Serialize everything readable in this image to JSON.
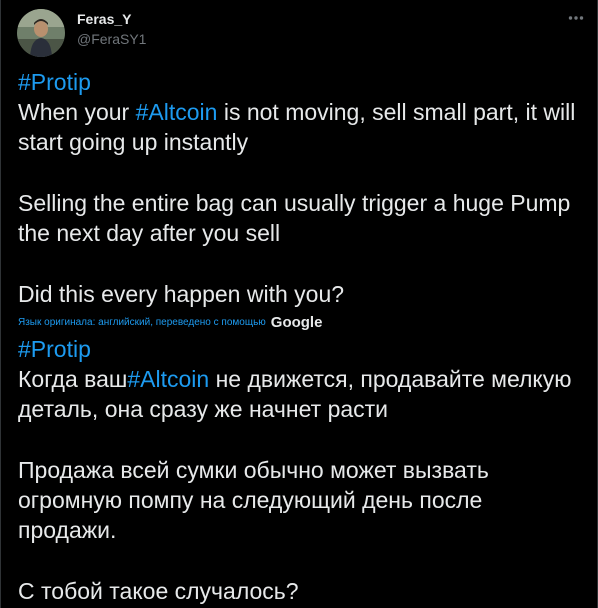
{
  "author": {
    "display_name": "Feras_Y",
    "handle": "@FeraSY1"
  },
  "icons": {
    "more": "more-horizontal-icon",
    "avatar": "avatar-photo"
  },
  "colors": {
    "background": "#000000",
    "text": "#e7e9ea",
    "muted": "#71767b",
    "link": "#1d9bf0"
  },
  "original": {
    "hashtag_1": "#Protip",
    "line_1_before": "When your ",
    "hashtag_2": "#Altcoin",
    "line_1_after": " is not moving, sell small part, it will start going up instantly",
    "paragraph_2": "Selling the entire bag can usually trigger a huge Pump the next day after you sell",
    "paragraph_3": "Did this every happen with you?"
  },
  "translation": {
    "note": "Язык оригинала: английский, переведено с помощью",
    "provider": "Google",
    "hashtag_1": "#Protip",
    "line_1_before": "Когда ваш",
    "hashtag_2": "#Altcoin",
    "line_1_after": " не движется, продавайте мелкую деталь, она сразу же начнет расти",
    "paragraph_2": " Продажа всей сумки обычно может вызвать огромную помпу на следующий день после продажи.",
    "paragraph_3": " С тобой такое случалось?"
  }
}
